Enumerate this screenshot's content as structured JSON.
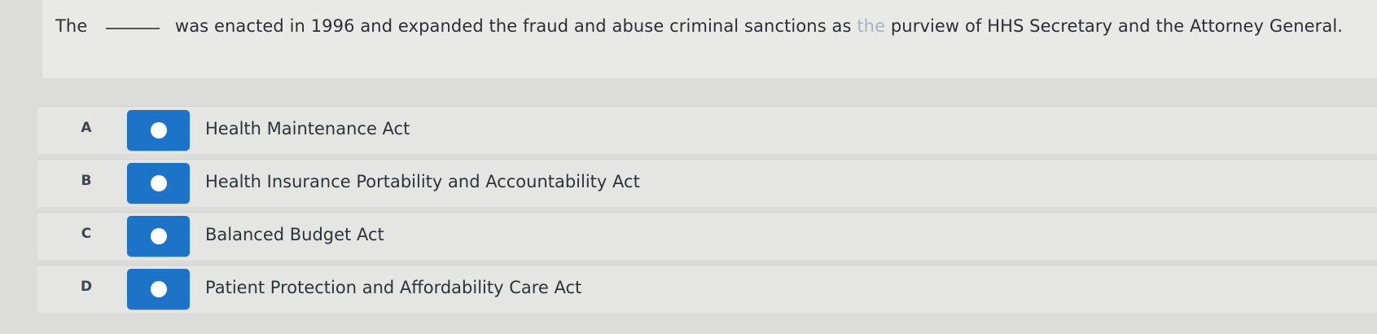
{
  "question": {
    "prefix": "The",
    "suffix": "was enacted in 1996 and expanded the fraud and abuse criminal sanctions as",
    "faded": "the",
    "end": "purview of HHS Secretary and the Attorney General."
  },
  "options": [
    {
      "letter": "A",
      "text": "Health Maintenance Act"
    },
    {
      "letter": "B",
      "text": "Health Insurance Portability and Accountability Act"
    },
    {
      "letter": "C",
      "text": "Balanced Budget Act"
    },
    {
      "letter": "D",
      "text": "Patient Protection and Affordability Care Act"
    }
  ],
  "colors": {
    "accent": "#1d73c8",
    "background": "#dcdcda",
    "text": "#2b2f33"
  }
}
